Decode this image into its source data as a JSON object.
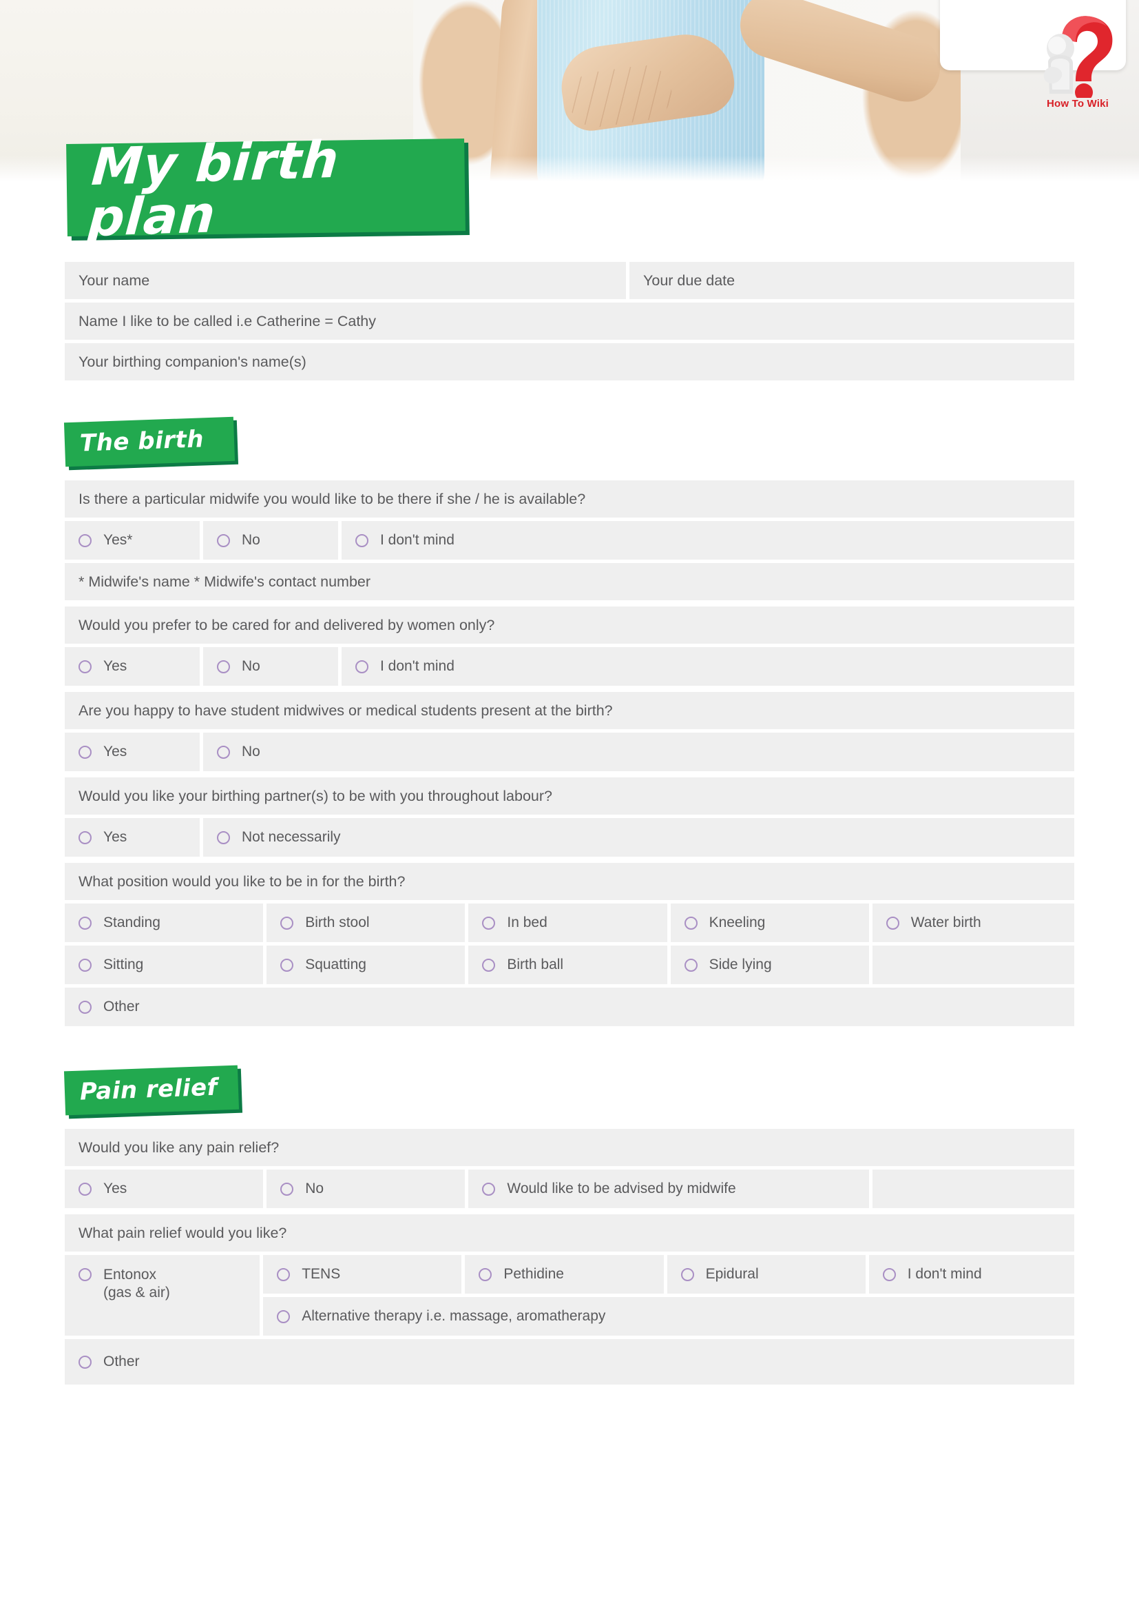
{
  "brand": {
    "logo_text": "How To Wiki",
    "logo_icon": "question-mark-icon",
    "accent_green": "#22a94f",
    "accent_green_dark": "#0c7b45",
    "accent_red": "#d81f26",
    "radio_color": "#a98fc4",
    "cell_bg": "#efefef",
    "text_color": "#5a5a5c"
  },
  "title": "My birth plan",
  "hero": {
    "photo_alt": "pregnant-woman-holding-belly-photo"
  },
  "personal": {
    "name_label": "Your name",
    "due_date_label": "Your due date",
    "preferred_name_label": "Name I like to be called i.e Catherine = Cathy",
    "companion_label": "Your birthing companion's name(s)"
  },
  "sections": [
    {
      "id": "the-birth",
      "heading": "The birth",
      "blocks": [
        {
          "question": "Is there a particular midwife you would like to be there if she / he is available?",
          "options": [
            "Yes*",
            "No",
            "I don't mind"
          ],
          "note": "* Midwife's name  * Midwife's contact number"
        },
        {
          "question": "Would you prefer to be cared for and delivered by women only?",
          "options": [
            "Yes",
            "No",
            "I don't mind"
          ]
        },
        {
          "question": "Are you happy to have student midwives or medical students present at the birth?",
          "options": [
            "Yes",
            "No"
          ]
        },
        {
          "question": "Would you like your birthing partner(s) to be with you throughout labour?",
          "options": [
            "Yes",
            "Not necessarily"
          ]
        },
        {
          "question": "What position would you like to be in for the birth?",
          "grid_row_1": [
            "Standing",
            "Birth stool",
            "In bed",
            "Kneeling",
            "Water birth"
          ],
          "grid_row_2": [
            "Sitting",
            "Squatting",
            "Birth ball",
            "Side lying"
          ],
          "other": "Other"
        }
      ]
    },
    {
      "id": "pain-relief",
      "heading": "Pain relief",
      "blocks": [
        {
          "question": "Would you like any pain relief?",
          "options": [
            "Yes",
            "No",
            "Would like to be advised by midwife"
          ]
        },
        {
          "question": "What pain relief would you like?",
          "entonox_line1": "Entonox",
          "entonox_line2": "(gas & air)",
          "grid_row_1": [
            "TENS",
            "Pethidine",
            "Epidural",
            "I don't mind"
          ],
          "alternative": "Alternative therapy i.e. massage, aromatherapy",
          "other": "Other"
        }
      ]
    }
  ]
}
